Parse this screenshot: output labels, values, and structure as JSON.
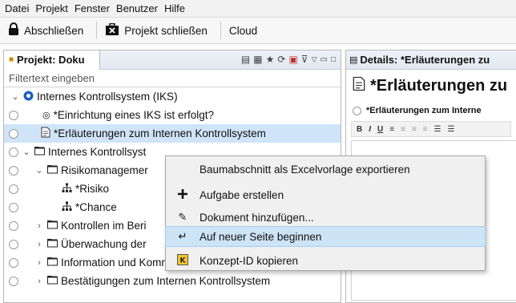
{
  "menubar": {
    "items": [
      "Datei",
      "Projekt",
      "Fenster",
      "Benutzer",
      "Hilfe"
    ]
  },
  "toolbar": {
    "lock_label": "Abschließen",
    "close_project_label": "Projekt schließen",
    "cloud_label": "Cloud"
  },
  "left_panel": {
    "tab_title": "Projekt: Doku",
    "filter_placeholder": "Filtertext eingeben",
    "tree": [
      {
        "label": "Internes Kontrollsystem (IKS)",
        "icon": "iks-globe-icon",
        "expanded": true,
        "level": 0,
        "radio": false
      },
      {
        "label": "*Einrichtung eines IKS ist erfolgt?",
        "icon": "question-icon",
        "level": 1,
        "radio": true
      },
      {
        "label": "*Erläuterungen zum Internen Kontrollsystem",
        "icon": "document-icon",
        "level": 1,
        "radio": true,
        "selected": true
      },
      {
        "label": "Internes Kontrollsyst",
        "icon": "folder-icon",
        "expanded": true,
        "level": 0,
        "radio": true
      },
      {
        "label": "Risikomanagemer",
        "icon": "folder-icon",
        "expanded": true,
        "level": 1,
        "radio": true
      },
      {
        "label": "*Risiko",
        "icon": "hierarchy-icon",
        "level": 2,
        "radio": true
      },
      {
        "label": "*Chance",
        "icon": "hierarchy-icon",
        "level": 2,
        "radio": true
      },
      {
        "label": "Kontrollen im Beri",
        "icon": "folder-icon",
        "expanded": false,
        "level": 1,
        "radio": true
      },
      {
        "label": "Überwachung der",
        "icon": "folder-icon",
        "expanded": false,
        "level": 1,
        "radio": true
      },
      {
        "label": "Information und Kommunikation",
        "icon": "folder-icon",
        "expanded": false,
        "level": 1,
        "radio": true
      },
      {
        "label": "Bestätigungen zum Internen Kontrollsystem",
        "icon": "folder-icon",
        "expanded": false,
        "level": 1,
        "radio": true
      }
    ]
  },
  "right_panel": {
    "tab_title": "Details: *Erläuterungen zu",
    "title": "*Erläuterungen zu",
    "subtitle": "*Erläuterungen zum Interne",
    "format_buttons": [
      "B",
      "I",
      "U"
    ]
  },
  "context_menu": {
    "items": [
      {
        "label": "Baumabschnitt als Excelvorlage exportieren",
        "icon": ""
      },
      {
        "label": "Aufgabe erstellen",
        "icon": "plus-icon"
      },
      {
        "label": "Dokument hinzufügen...",
        "icon": "paperclip-icon"
      },
      {
        "label": "Auf neuer Seite beginnen",
        "icon": "page-break-icon",
        "highlighted": true
      },
      {
        "label": "Konzept-ID kopieren",
        "icon": "copy-id-icon"
      }
    ]
  },
  "colors": {
    "selection": "#cfe4f8",
    "menu_highlight": "#cde4f7",
    "iks_blue": "#1f5fbf",
    "accent_gold": "#c58a00"
  }
}
